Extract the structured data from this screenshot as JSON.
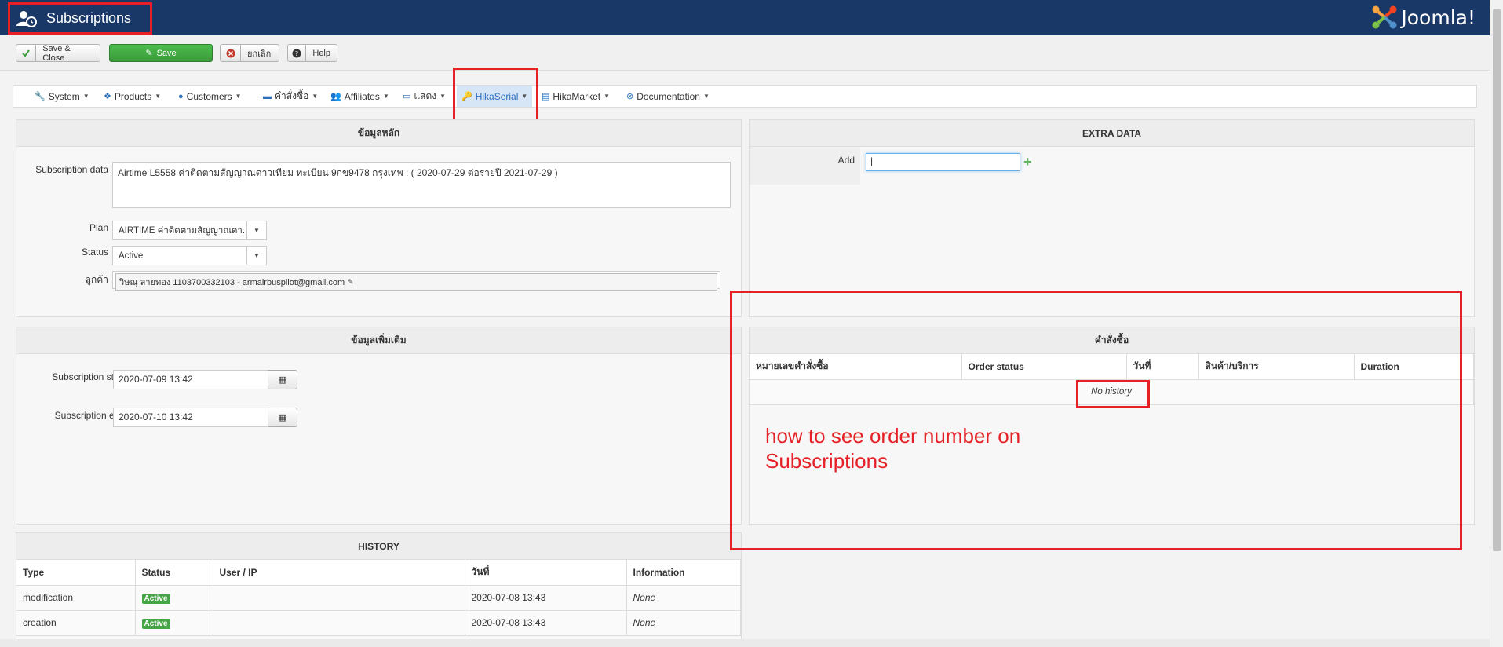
{
  "header": {
    "title": "Subscriptions",
    "brand": "Joomla!",
    "brand_icon": "joomla-logo-icon",
    "title_icon": "users-clock-icon"
  },
  "toolbar": {
    "save_close_label": "Save & Close",
    "save_label": "Save",
    "cancel_label": "ยกเลิก",
    "help_label": "Help"
  },
  "menu": {
    "items": [
      {
        "label": "System",
        "icon": "wrench-icon"
      },
      {
        "label": "Products",
        "icon": "cubes-icon"
      },
      {
        "label": "Customers",
        "icon": "user-icon"
      },
      {
        "label": "คำสั่งซื้อ",
        "icon": "credit-card-icon"
      },
      {
        "label": "Affiliates",
        "icon": "users-icon"
      },
      {
        "label": "แสดง",
        "icon": "monitor-icon"
      },
      {
        "label": "HikaSerial",
        "icon": "key-icon"
      },
      {
        "label": "HikaMarket",
        "icon": "store-icon"
      },
      {
        "label": "Documentation",
        "icon": "life-ring-icon"
      }
    ]
  },
  "main_panel": {
    "title": "ข้อมูลหลัก",
    "subscription_data_label": "Subscription data",
    "subscription_data_value": "Airtime L5558 ค่าติดตามสัญญาณดาวเทียม ทะเบียน 9กข9478 กรุงเทพ : ( 2020-07-29 ต่อรายปี 2021-07-29 )",
    "plan_label": "Plan",
    "plan_value": "AIRTIME ค่าติดตามสัญญาณดา...",
    "status_label": "Status",
    "status_value": "Active",
    "customer_label": "ลูกค้า",
    "customer_value": "วิษณุ สายทอง 1103700332103 - armairbuspilot@gmail.com"
  },
  "extra_panel": {
    "title": "ข้อมูลเพิ่มเติม",
    "start_label": "Subscription start",
    "start_value": "2020-07-09 13:42",
    "end_label": "Subscription end",
    "end_value": "2020-07-10 13:42"
  },
  "extra_data_panel": {
    "title": "EXTRA DATA",
    "add_label": "Add",
    "add_value": "|"
  },
  "orders_panel": {
    "title": "คำสั่งซื้อ",
    "columns": [
      "หมายเลขคำสั่งซื้อ",
      "Order status",
      "วันที่",
      "สินค้า/บริการ",
      "Duration"
    ],
    "empty_text": "No history"
  },
  "history_panel": {
    "title": "HISTORY",
    "columns": [
      "Type",
      "Status",
      "User / IP",
      "วันที่",
      "Information"
    ],
    "rows": [
      {
        "type": "modification",
        "status": "Active",
        "user": "",
        "date": "2020-07-08 13:43",
        "info": "None"
      },
      {
        "type": "creation",
        "status": "Active",
        "user": "",
        "date": "2020-07-08 13:43",
        "info": "None"
      }
    ]
  },
  "annotation": {
    "line1": "how to see order number on",
    "line2": "Subscriptions",
    "color": "#e52127"
  },
  "colors": {
    "header_bg": "#1a3867",
    "save_green": "#46a546",
    "annotation_red": "#e52127"
  }
}
